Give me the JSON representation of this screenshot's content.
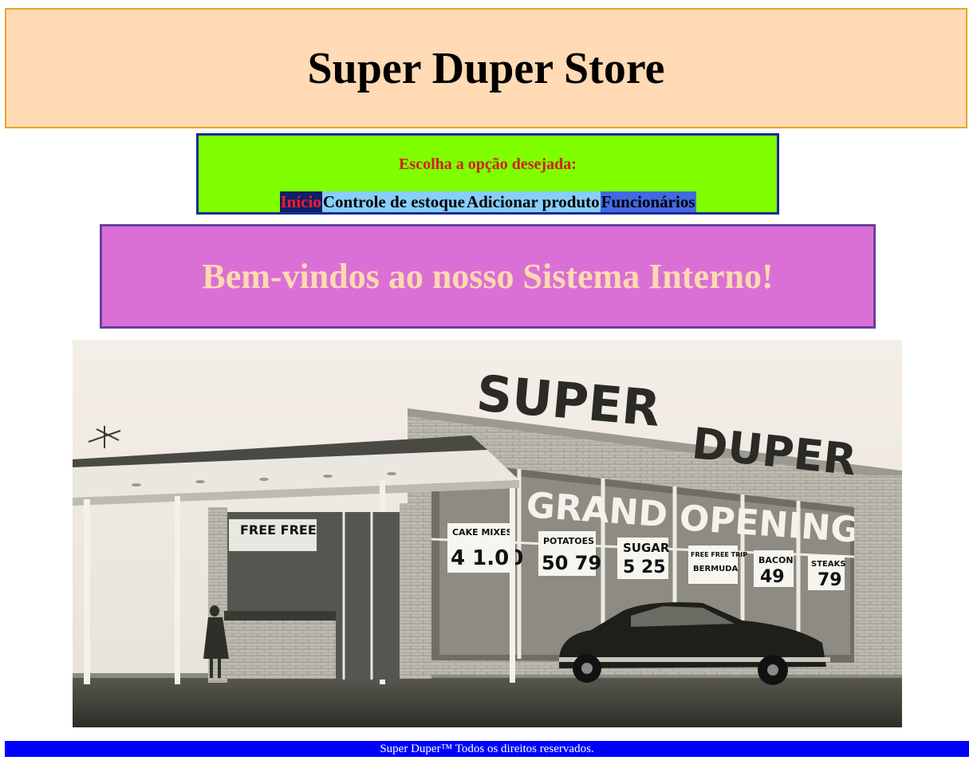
{
  "header": {
    "title": "Super Duper Store"
  },
  "menu": {
    "prompt": "Escolha a opção desejada:",
    "items": [
      {
        "label": "Início"
      },
      {
        "label": "Controle de estoque"
      },
      {
        "label": "Adicionar produto"
      },
      {
        "label": "Funcionários"
      }
    ]
  },
  "welcome": {
    "heading": "Bem-vindos ao nosso Sistema Interno!"
  },
  "photo": {
    "sign_word_1": "SUPER",
    "sign_word_2": "DUPER",
    "window_words": [
      "GRAND",
      "OPENING"
    ],
    "price_signs": [
      {
        "item": "CAKE MIXES",
        "price": "4 1.00"
      },
      {
        "item": "POTATOES",
        "price": "50 79"
      },
      {
        "item": "SUGAR",
        "price": "5 25"
      },
      {
        "item": "FREE FREE TRIP",
        "price": "BERMUDA"
      },
      {
        "item": "BACON",
        "price": "49"
      },
      {
        "item": "STEAKS",
        "price": "79"
      }
    ],
    "door_sign": "FREE FREE"
  },
  "footer": {
    "text": "Super Duper™ Todos os direitos reservados."
  },
  "colors": {
    "header_bg": "#ffdab4",
    "header_border": "#e5a52a",
    "menu_bg": "#80ff00",
    "menu_border": "#1a2c96",
    "prompt_color": "#d11f1f",
    "welcome_bg": "#da70d6",
    "welcome_text": "#ffd9b0",
    "footer_bg": "#0000ff"
  }
}
